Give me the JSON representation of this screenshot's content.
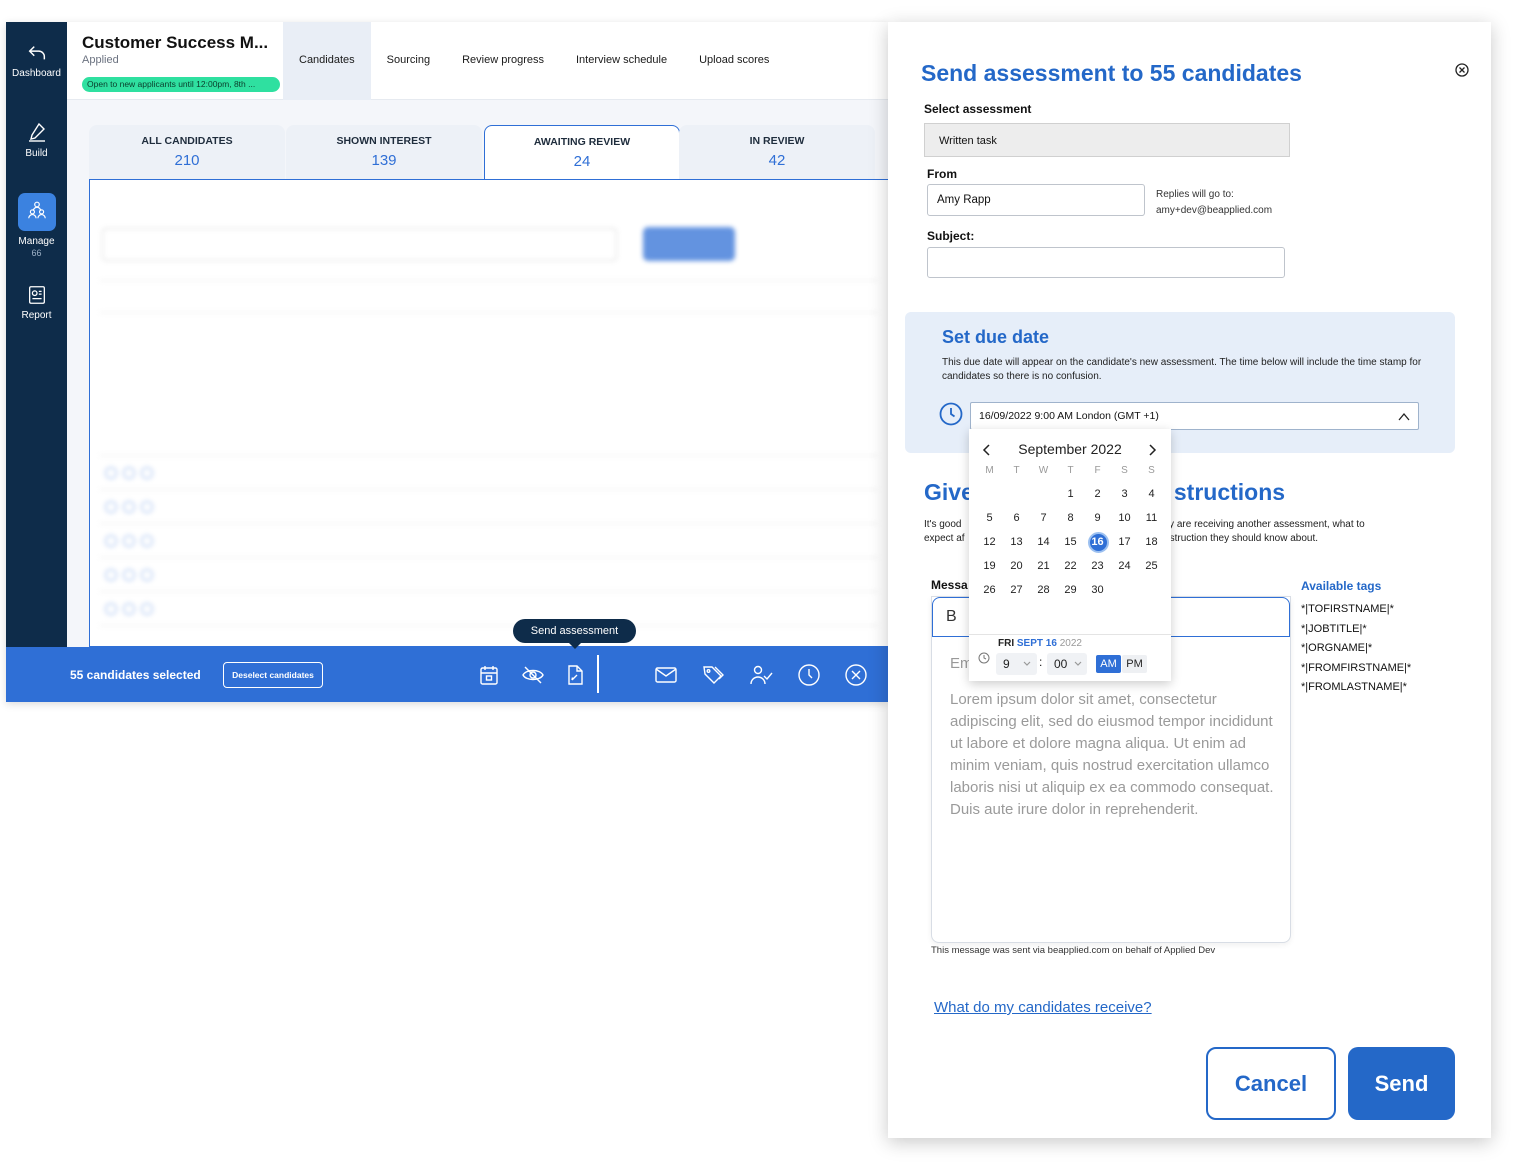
{
  "sidebar": {
    "items": [
      {
        "label": "Dashboard",
        "icon": "back-arrow-icon"
      },
      {
        "label": "Build",
        "icon": "pen-icon"
      },
      {
        "label": "Manage",
        "icon": "people-icon",
        "count": "66"
      },
      {
        "label": "Report",
        "icon": "report-icon"
      }
    ]
  },
  "header": {
    "job_title": "Customer Success M...",
    "job_status": "Applied",
    "badge": "Open to new applicants until 12:00pm, 8th ...",
    "tabs": [
      "Candidates",
      "Sourcing",
      "Review progress",
      "Interview schedule",
      "Upload scores"
    ]
  },
  "stats": [
    {
      "label": "ALL CANDIDATES",
      "value": "210"
    },
    {
      "label": "SHOWN INTEREST",
      "value": "139"
    },
    {
      "label": "AWAITING REVIEW",
      "value": "24"
    },
    {
      "label": "IN REVIEW",
      "value": "42"
    }
  ],
  "actionbar": {
    "selected": "55 candidates selected",
    "deselect": "Deselect candidates",
    "tooltip": "Send assessment"
  },
  "modal": {
    "title": "Send assessment to 55 candidates",
    "select_label": "Select assessment",
    "select_value": "Written task",
    "from_label": "From",
    "from_value": "Amy Rapp",
    "replies_label": "Replies will go to:",
    "replies_email": "amy+dev@beapplied.com",
    "subject_label": "Subject:",
    "subject_value": "",
    "due": {
      "title": "Set due date",
      "desc": "This due date will appear on the candidate's new assessment. The time below will include the time stamp for candidates so there is no confusion.",
      "value": "16/09/2022 9:00 AM London (GMT +1)"
    },
    "give_title_a": "Give",
    "give_title_b": "structions",
    "give_desc_a": "It's good",
    "give_desc_b": "ey are receiving another assessment, what to",
    "give_desc_c": "expect af",
    "give_desc_d": "struction they should know about.",
    "message_label": "Messa",
    "editor_bold": "B",
    "editor_em": "Em",
    "editor_body": "Lorem ipsum dolor sit amet, consectetur adipiscing elit, sed do eiusmod tempor incididunt ut labore et dolore magna aliqua. Ut enim ad minim veniam, quis nostrud exercitation ullamco laboris nisi ut aliquip ex ea commodo consequat. Duis aute irure dolor in reprehenderit.",
    "sent_note": "This message was sent via beapplied.com on behalf of Applied Dev",
    "tags_title": "Available tags",
    "tags": [
      "*|TOFIRSTNAME|*",
      "*|JOBTITLE|*",
      "*|ORGNAME|*",
      "*|FROMFIRSTNAME|*",
      "*|FROMLASTNAME|*"
    ],
    "link": "What do my candidates receive?",
    "cancel": "Cancel",
    "send": "Send"
  },
  "calendar": {
    "month": "September 2022",
    "dow": [
      "M",
      "T",
      "W",
      "T",
      "F",
      "S",
      "S"
    ],
    "weeks": [
      [
        "",
        "",
        "",
        "1",
        "2",
        "3",
        "4"
      ],
      [
        "5",
        "6",
        "7",
        "8",
        "9",
        "10",
        "11"
      ],
      [
        "12",
        "13",
        "14",
        "15",
        "16",
        "17",
        "18"
      ],
      [
        "19",
        "20",
        "21",
        "22",
        "23",
        "24",
        "25"
      ],
      [
        "26",
        "27",
        "28",
        "29",
        "30",
        "",
        ""
      ]
    ],
    "selected_day": "16",
    "date_day": "FRI",
    "date_md": "SEPT 16",
    "date_year": "2022",
    "hour": "9",
    "minute": "00",
    "am": "AM",
    "pm": "PM"
  },
  "colors": {
    "accent": "#2468c8",
    "nav": "#0e2c4a",
    "badge": "#2fe0a0"
  }
}
